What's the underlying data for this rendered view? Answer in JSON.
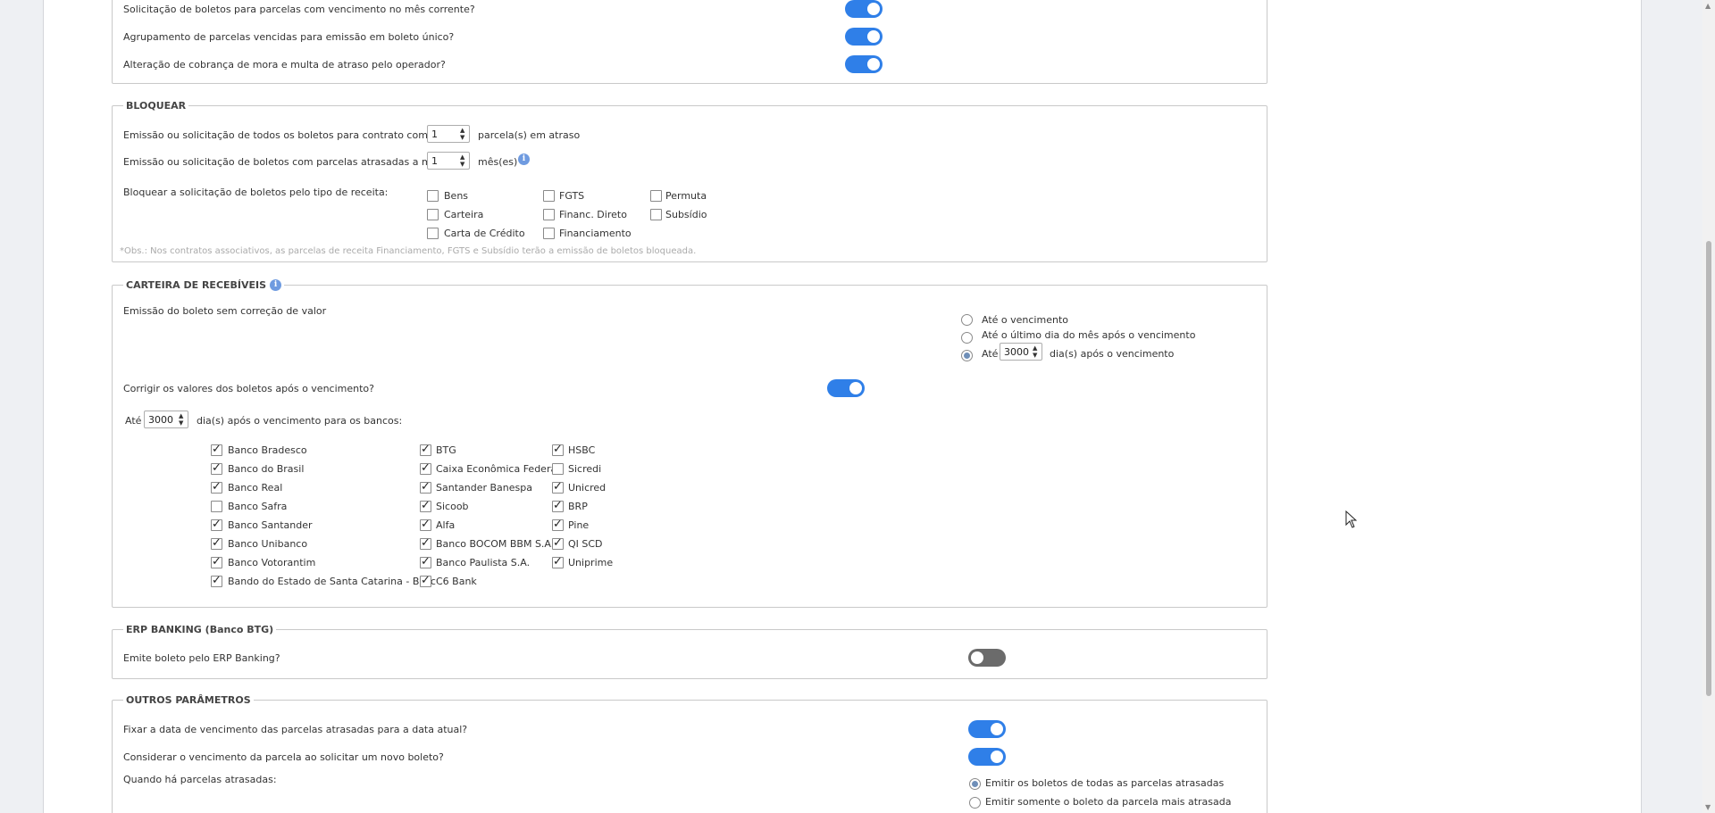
{
  "top": {
    "rows": [
      {
        "label": "Solicitação de boletos para parcelas com vencimento no mês corrente?",
        "on": true
      },
      {
        "label": "Agrupamento de parcelas vencidas para emissão em boleto único?",
        "on": true
      },
      {
        "label": "Alteração de cobrança de mora e multa de atraso pelo operador?",
        "on": true
      }
    ]
  },
  "bloquear": {
    "title": "BLOQUEAR",
    "row1_label": "Emissão ou solicitação de todos os boletos para contrato com mais de",
    "row1_value": "1",
    "row1_suffix": "parcela(s) em atraso",
    "row2_label": "Emissão ou solicitação de boletos com parcelas atrasadas a mais de",
    "row2_value": "1",
    "row2_suffix": "mês(es)",
    "receita_label": "Bloquear a solicitação de boletos pelo tipo de receita:",
    "receitas": [
      {
        "label": "Bens",
        "checked": false
      },
      {
        "label": "FGTS",
        "checked": false
      },
      {
        "label": "Permuta",
        "checked": false
      },
      {
        "label": "Carteira",
        "checked": false
      },
      {
        "label": "Financ. Direto",
        "checked": false
      },
      {
        "label": "Subsídio",
        "checked": false
      },
      {
        "label": "Carta de Crédito",
        "checked": false
      },
      {
        "label": "Financiamento",
        "checked": false
      }
    ],
    "obs": "*Obs.: Nos contratos associativos, as parcelas de receita Financiamento, FGTS e Subsídio terão a emissão de boletos bloqueada."
  },
  "carteira": {
    "title": "CARTEIRA DE RECEBÍVEIS",
    "emissao_label": "Emissão do boleto sem correção de valor",
    "radio_options": [
      {
        "label": "Até o vencimento",
        "selected": false
      },
      {
        "label": "Até o último dia do mês após o vencimento",
        "selected": false
      },
      {
        "label": "Até",
        "selected": true
      }
    ],
    "radio_days_value": "3000",
    "radio_days_suffix": "dia(s) após o vencimento",
    "corrigir_label": "Corrigir os valores dos boletos após o vencimento?",
    "corrigir_on": true,
    "ate_label": "Até",
    "ate_value": "3000",
    "ate_suffix": "dia(s) após o vencimento para os bancos:",
    "banks_col1": [
      {
        "label": "Banco Bradesco",
        "checked": true
      },
      {
        "label": "Banco do Brasil",
        "checked": true
      },
      {
        "label": "Banco Real",
        "checked": true
      },
      {
        "label": "Banco Safra",
        "checked": false
      },
      {
        "label": "Banco Santander",
        "checked": true
      },
      {
        "label": "Banco Unibanco",
        "checked": true
      },
      {
        "label": "Banco Votorantim",
        "checked": true
      },
      {
        "label": "Bando do Estado de Santa Catarina - Besc",
        "checked": true
      }
    ],
    "banks_col2": [
      {
        "label": "BTG",
        "checked": true
      },
      {
        "label": "Caixa Econômica Federal",
        "checked": true
      },
      {
        "label": "Santander Banespa",
        "checked": true
      },
      {
        "label": "Sicoob",
        "checked": true
      },
      {
        "label": "Alfa",
        "checked": true
      },
      {
        "label": "Banco BOCOM BBM S.A.",
        "checked": true
      },
      {
        "label": "Banco Paulista S.A.",
        "checked": true
      },
      {
        "label": "C6 Bank",
        "checked": true
      }
    ],
    "banks_col3": [
      {
        "label": "HSBC",
        "checked": true
      },
      {
        "label": "Sicredi",
        "checked": false
      },
      {
        "label": "Unicred",
        "checked": true
      },
      {
        "label": "BRP",
        "checked": true
      },
      {
        "label": "Pine",
        "checked": true
      },
      {
        "label": "QI SCD",
        "checked": true
      },
      {
        "label": "Uniprime",
        "checked": true
      }
    ]
  },
  "erp": {
    "title": "ERP BANKING (Banco BTG)",
    "label": "Emite boleto pelo ERP Banking?",
    "on": false
  },
  "outros": {
    "title": "OUTROS PARÂMETROS",
    "row1_label": "Fixar a data de vencimento das parcelas atrasadas para a data atual?",
    "row1_on": true,
    "row2_label": "Considerar o vencimento da parcela ao solicitar um novo boleto?",
    "row2_on": true,
    "row3_label": "Quando há parcelas atrasadas:",
    "options": [
      {
        "label": "Emitir os boletos de todas as parcelas atrasadas",
        "selected": true
      },
      {
        "label": "Emitir somente o boleto da parcela mais atrasada",
        "selected": false
      }
    ]
  },
  "colors": {
    "toggle_on": "#2f7fe8",
    "toggle_off": "#6b6b6b",
    "info": "#6f9be0"
  }
}
